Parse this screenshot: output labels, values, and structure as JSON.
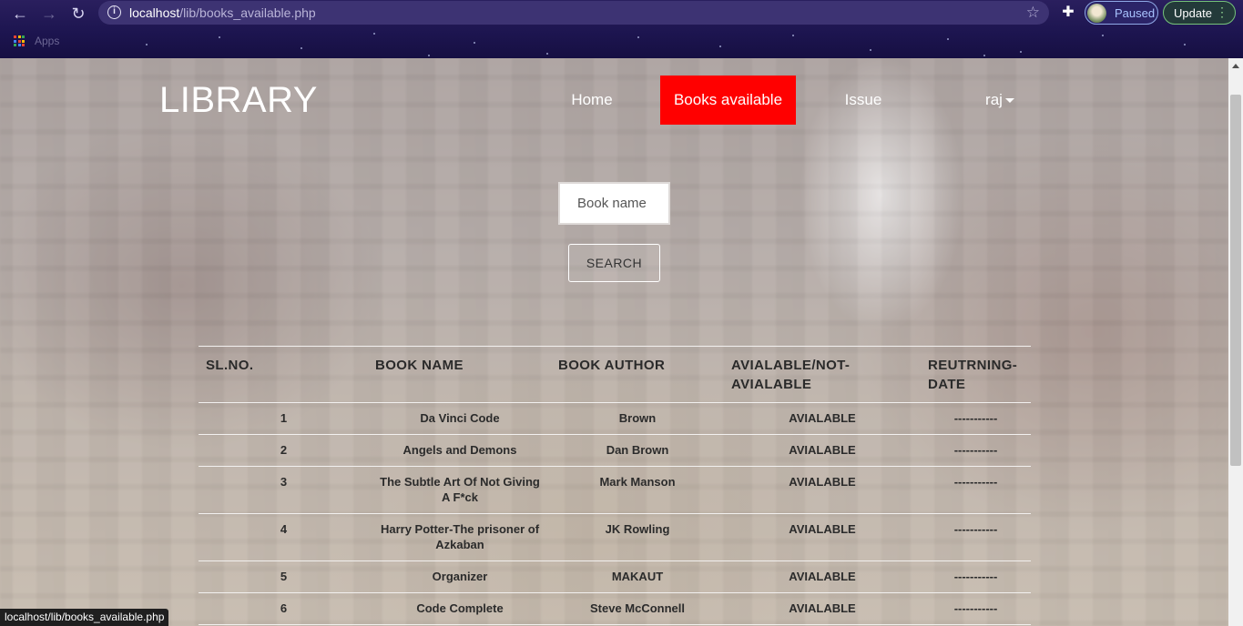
{
  "browser": {
    "url_host": "localhost",
    "url_path": "/lib/books_available.php",
    "profile_label": "Paused",
    "update_label": "Update",
    "bookmarks_apps_label": "Apps",
    "status_url": "localhost/lib/books_available.php"
  },
  "header": {
    "logo": "LIBRARY",
    "nav": {
      "home": "Home",
      "books_available": "Books available",
      "issue": "Issue",
      "user": "raj"
    },
    "active_color": "#ff0000"
  },
  "search": {
    "placeholder": "Book name",
    "button_label": "SEARCH"
  },
  "table": {
    "headers": {
      "sl": "SL.NO.",
      "name": "BOOK NAME",
      "author": "BOOK AUTHOR",
      "available": "AVIALABLE/NOT-AVIALABLE",
      "return_date": "REUTRNING-DATE"
    },
    "rows": [
      {
        "sl": "1",
        "name": "Da Vinci Code",
        "author": "Brown",
        "status": "AVIALABLE",
        "date": "-----------"
      },
      {
        "sl": "2",
        "name": "Angels and Demons",
        "author": "Dan Brown",
        "status": "AVIALABLE",
        "date": "-----------"
      },
      {
        "sl": "3",
        "name": "The Subtle Art Of Not Giving A F*ck",
        "author": "Mark Manson",
        "status": "AVIALABLE",
        "date": "-----------"
      },
      {
        "sl": "4",
        "name": "Harry Potter-The prisoner of Azkaban",
        "author": "JK Rowling",
        "status": "AVIALABLE",
        "date": "-----------"
      },
      {
        "sl": "5",
        "name": "Organizer",
        "author": "MAKAUT",
        "status": "AVIALABLE",
        "date": "-----------"
      },
      {
        "sl": "6",
        "name": "Code Complete",
        "author": "Steve McConnell",
        "status": "AVIALABLE",
        "date": "-----------"
      }
    ]
  }
}
